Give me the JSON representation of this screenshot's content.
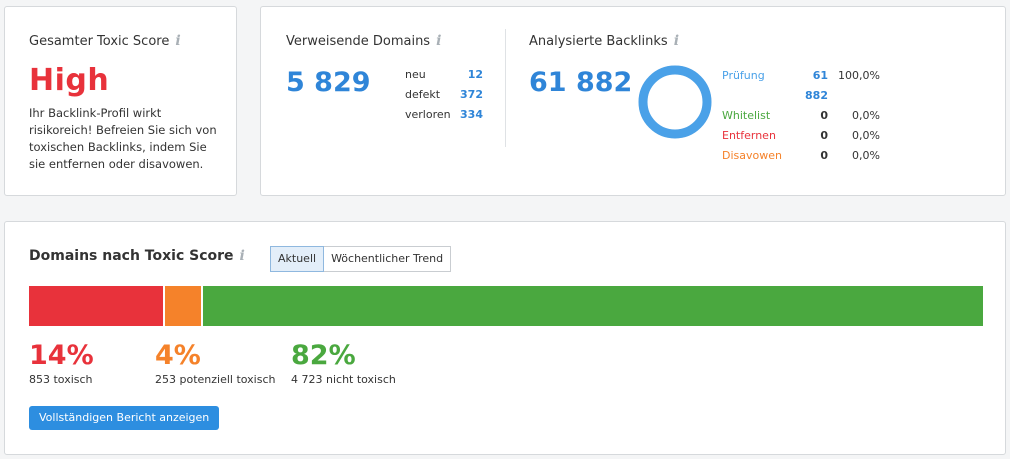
{
  "toxic_score_card": {
    "title": "Gesamter Toxic Score",
    "level": "High",
    "level_color": "#e8323b",
    "description": "Ihr Backlink-Profil wirkt risikoreich! Befreien Sie sich von toxischen Backlinks, indem Sie sie entfernen oder disavowen."
  },
  "referring_domains": {
    "title": "Verweisende Domains",
    "total": "5 829",
    "stats": [
      {
        "label": "neu",
        "value": "12"
      },
      {
        "label": "defekt",
        "value": "372"
      },
      {
        "label": "verloren",
        "value": "334"
      }
    ]
  },
  "analyzed_backlinks": {
    "title": "Analysierte Backlinks",
    "total": "61 882",
    "donut_fraction_pruefung": 1.0,
    "legend": [
      {
        "label": "Prüfung",
        "value": "61 882",
        "pct": "100,0%",
        "color": "#4aa1e8",
        "value_color": "#2f85d8"
      },
      {
        "label": "Whitelist",
        "value": "0",
        "pct": "0,0%",
        "color": "#4aa83f",
        "value_color": "#333333"
      },
      {
        "label": "Entfernen",
        "value": "0",
        "pct": "0,0%",
        "color": "#e8323b",
        "value_color": "#333333"
      },
      {
        "label": "Disavowen",
        "value": "0",
        "pct": "0,0%",
        "color": "#f5822a",
        "value_color": "#333333"
      }
    ]
  },
  "domains_by_score": {
    "title": "Domains nach Toxic Score",
    "tabs": [
      {
        "label": "Aktuell",
        "active": true
      },
      {
        "label": "Wöchentlicher Trend",
        "active": false
      }
    ],
    "segments": [
      {
        "pct_text": "14%",
        "label": "853 toxisch",
        "fraction": 0.14,
        "color": "#e8323b"
      },
      {
        "pct_text": "4%",
        "label": "253 potenziell toxisch",
        "fraction": 0.04,
        "color": "#f5822a"
      },
      {
        "pct_text": "82%",
        "label": "4 723 nicht toxisch",
        "fraction": 0.82,
        "color": "#4aa83f"
      }
    ],
    "report_button": "Vollständigen Bericht anzeigen"
  },
  "colors": {
    "accent_blue": "#2f85d8",
    "button_blue": "#2d8ee0"
  }
}
